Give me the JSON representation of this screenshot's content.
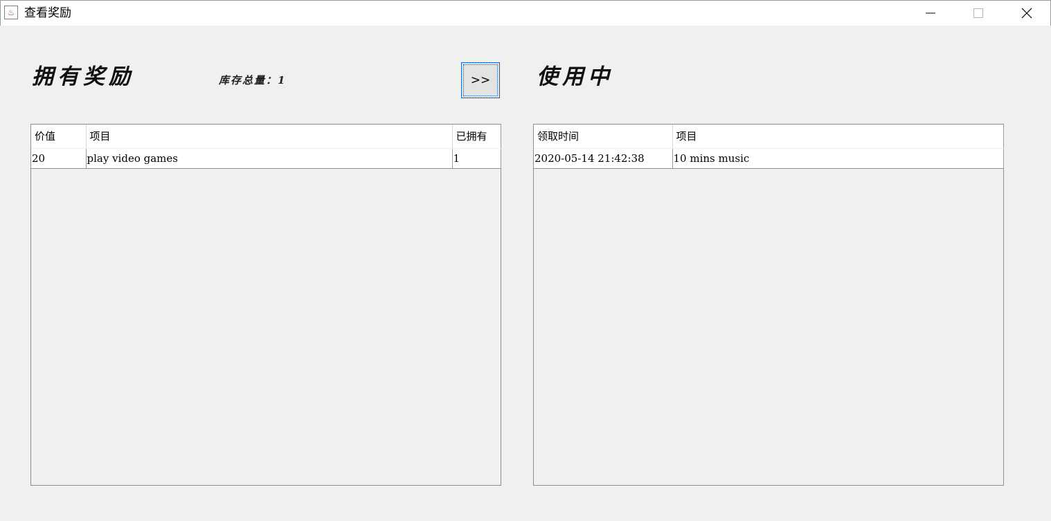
{
  "window": {
    "title": "查看奖励",
    "icon": "java-cup-icon",
    "icon_glyph": "♨",
    "controls": {
      "minimize": "minimize-icon",
      "maximize": "maximize-icon",
      "close": "close-icon"
    }
  },
  "owned": {
    "heading": "拥有奖励",
    "stock_text": "库存总量：1",
    "columns": [
      "价值",
      "项目",
      "已拥有"
    ],
    "rows": [
      [
        "20",
        "play video games",
        "1"
      ]
    ]
  },
  "move_button": {
    "label": ">>"
  },
  "in_use": {
    "heading": "使用中",
    "columns": [
      "领取时间",
      "项目"
    ],
    "rows": [
      [
        "2020-05-14 21:42:38",
        "10 mins music"
      ]
    ]
  }
}
